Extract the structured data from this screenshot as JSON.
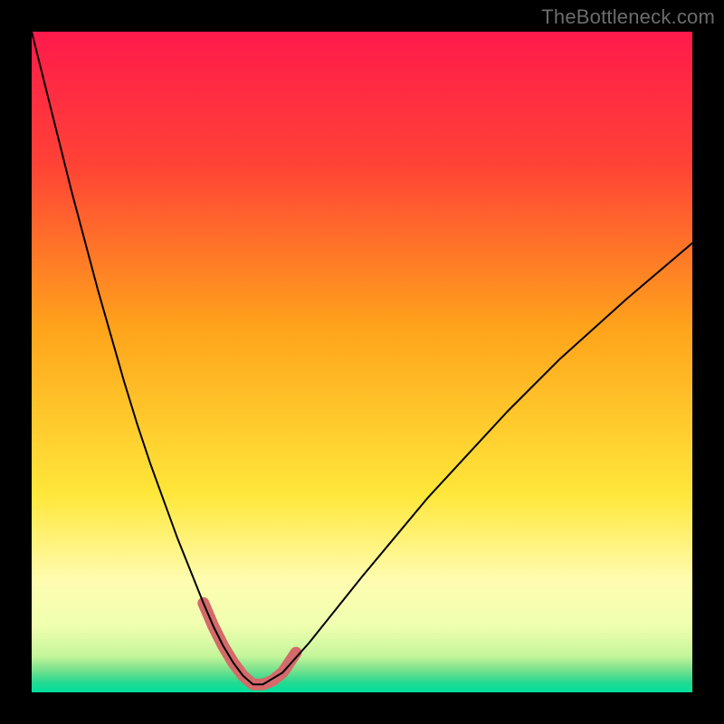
{
  "watermark": "TheBottleneck.com",
  "chart_data": {
    "type": "line",
    "title": "",
    "xlabel": "",
    "ylabel": "",
    "xlim": [
      0,
      100
    ],
    "ylim": [
      0,
      100
    ],
    "grid": false,
    "background_gradient": {
      "type": "vertical-linear",
      "stops": [
        {
          "offset": 0.0,
          "color": "#ff1a4b"
        },
        {
          "offset": 0.2,
          "color": "#ff4236"
        },
        {
          "offset": 0.45,
          "color": "#ffa41b"
        },
        {
          "offset": 0.7,
          "color": "#ffe73a"
        },
        {
          "offset": 0.83,
          "color": "#fffcb0"
        },
        {
          "offset": 0.9,
          "color": "#efffb0"
        },
        {
          "offset": 0.945,
          "color": "#c5f59a"
        },
        {
          "offset": 0.965,
          "color": "#7de28e"
        },
        {
          "offset": 0.985,
          "color": "#25d990"
        },
        {
          "offset": 1.0,
          "color": "#00e09b"
        }
      ]
    },
    "series": [
      {
        "name": "bottleneck-curve",
        "type": "line",
        "stroke": "#000000",
        "stroke_width": 2,
        "x": [
          0,
          2,
          4,
          6,
          8,
          10,
          12,
          14,
          16,
          18,
          20,
          22,
          24,
          26,
          27.5,
          29,
          30.5,
          32,
          33.5,
          35,
          38,
          42,
          46,
          50,
          55,
          60,
          66,
          72,
          80,
          90,
          100
        ],
        "y": [
          100,
          92,
          84,
          76,
          68.5,
          61,
          54,
          47,
          40.5,
          34.5,
          29,
          23.5,
          18.5,
          13.5,
          10,
          7,
          4.5,
          2.5,
          1.2,
          1.2,
          3,
          7.5,
          12.5,
          17.5,
          23.5,
          29.5,
          36,
          42.5,
          50.5,
          59.5,
          68
        ]
      },
      {
        "name": "valley-highlight",
        "type": "line",
        "stroke": "#d46a6a",
        "stroke_width": 13,
        "stroke_linecap": "round",
        "stroke_linejoin": "round",
        "x": [
          26,
          27.5,
          29,
          30.5,
          32,
          33.5,
          35
        ],
        "y": [
          13.5,
          10,
          7,
          4.5,
          2.5,
          1.2,
          1.2
        ],
        "reverse_tail_x": [
          35,
          36.5,
          38
        ],
        "reverse_tail_y": [
          1.2,
          1.8,
          3.0
        ],
        "full_x": [
          26,
          27.5,
          29,
          30.5,
          32,
          33.5,
          35,
          36.5,
          38,
          39,
          40
        ],
        "full_y": [
          13.5,
          10,
          7,
          4.5,
          2.5,
          1.2,
          1.2,
          1.8,
          3.0,
          4.5,
          6.0
        ]
      }
    ],
    "annotations": []
  }
}
